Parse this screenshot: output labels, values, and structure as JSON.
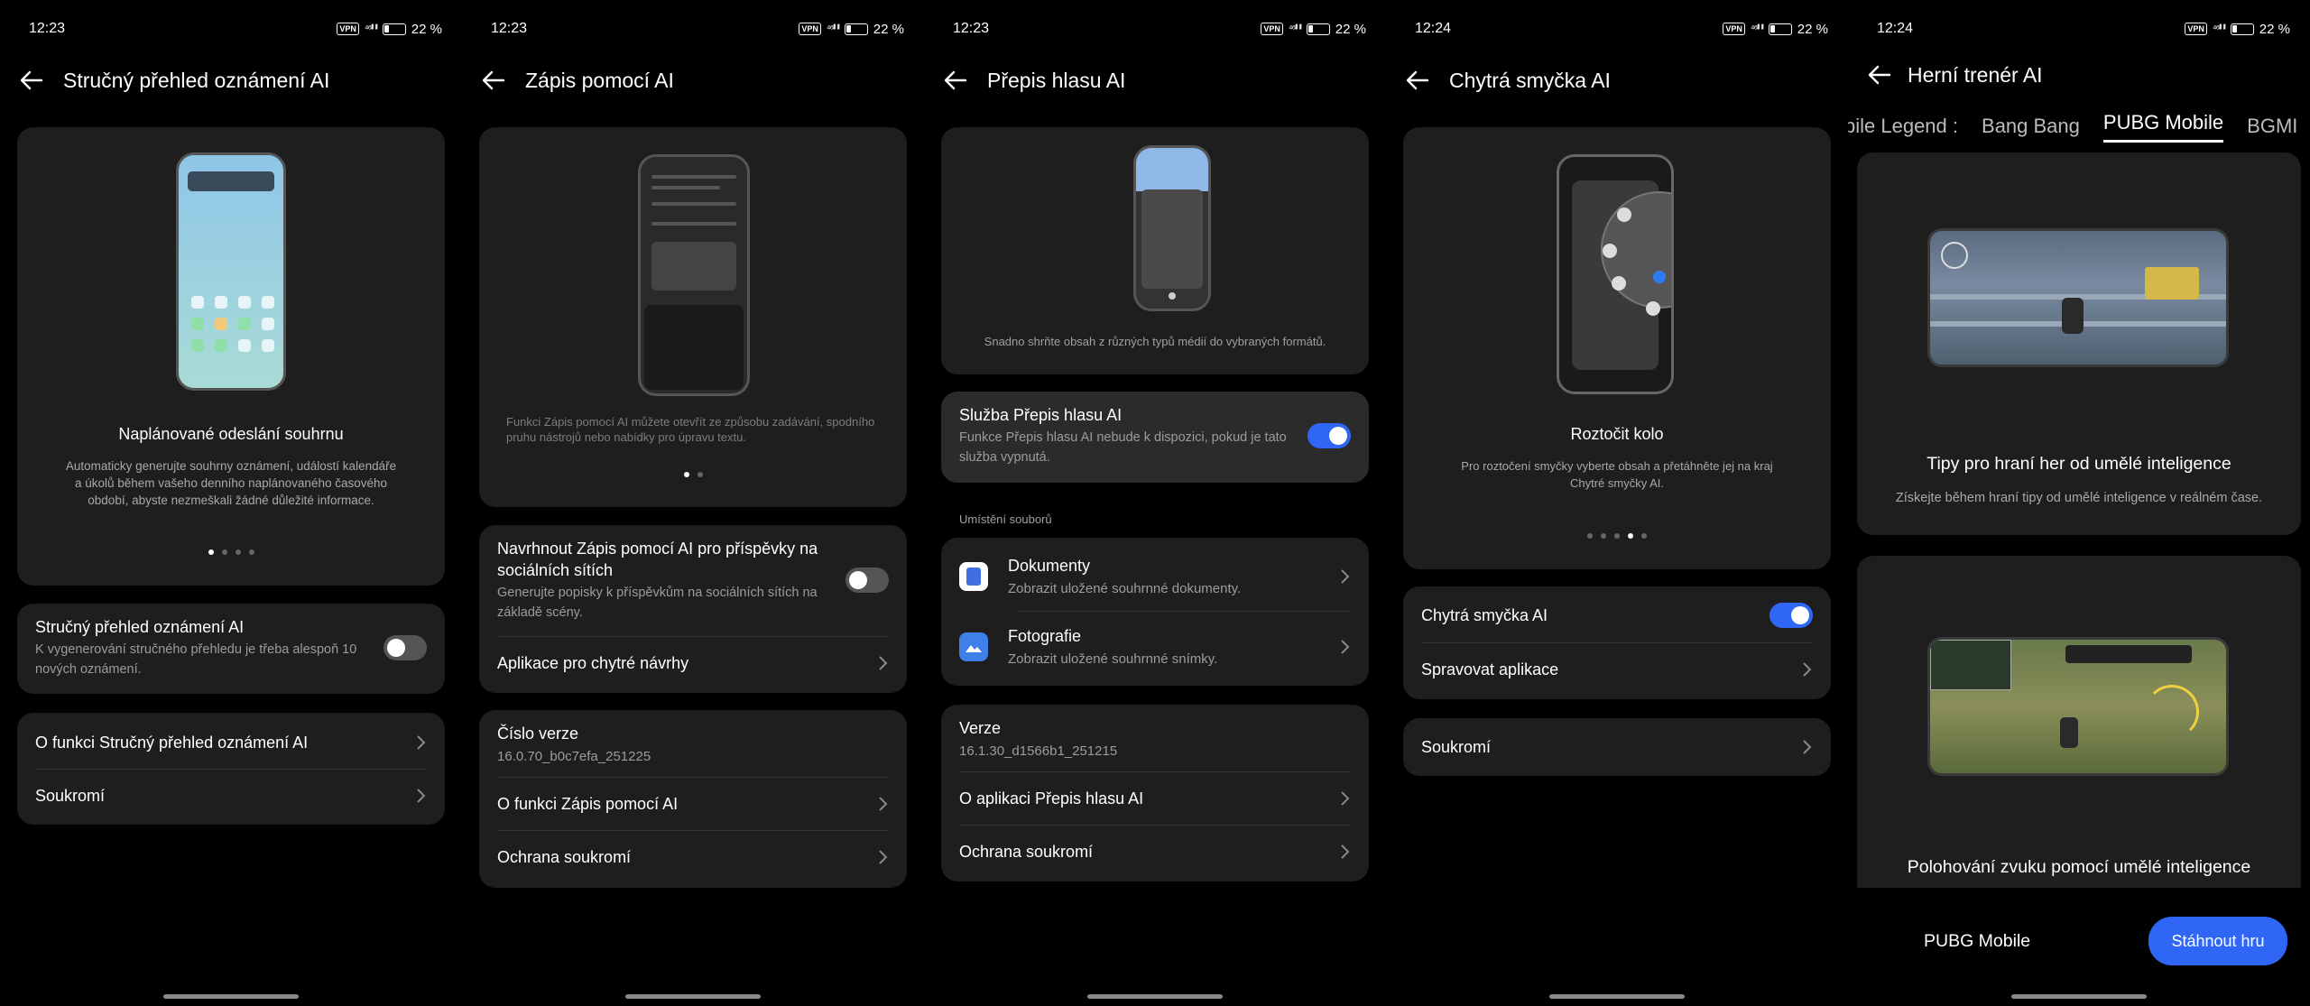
{
  "panels": [
    {
      "status": {
        "time": "12:23",
        "battery": "22 %",
        "vpn": "VPN",
        "signal": "⁴⁶ᴵˡˡ ᴵˡˡ"
      },
      "title": "Stručný přehled oznámení AI",
      "card": {
        "heading": "Naplánované odeslání souhrnu",
        "caption": "Automaticky generujte souhrny oznámení, událostí kalendáře a úkolů během vašeho denního naplánovaného časového období, abyste nezmeškali žádné důležité informace."
      },
      "toggle_row": {
        "title": "Stručný přehled oznámení AI",
        "sub": "K vygenerování stručného přehledu je třeba alespoň 10 nových oznámení.",
        "on": false
      },
      "links": [
        "O funkci Stručný přehled oznámení AI",
        "Soukromí"
      ]
    },
    {
      "status": {
        "time": "12:23",
        "battery": "22 %",
        "vpn": "VPN",
        "signal": "⁴⁶ᴵˡˡ ᴵˡˡ"
      },
      "title": "Zápis pomocí AI",
      "card": {
        "caption": "Funkci Zápis pomocí AI můžete otevřít ze způsobu zadávání, spodního pruhu nástrojů nebo nabídky pro úpravu textu."
      },
      "toggle_row": {
        "title": "Navrhnout Zápis pomocí AI pro příspěvky na sociálních sítích",
        "sub": "Generujte popisky k příspěvkům na sociálních sítích na základě scény.",
        "on": false
      },
      "suggest_apps": "Aplikace pro chytré návrhy",
      "version_label": "Číslo verze",
      "version": "16.0.70_b0c7efa_251225",
      "links": [
        "O funkci Zápis pomocí AI",
        "Ochrana soukromí"
      ]
    },
    {
      "status": {
        "time": "12:23",
        "battery": "22 %",
        "vpn": "VPN",
        "signal": "⁴⁶ᴵˡˡ ᴵˡˡ"
      },
      "title": "Přepis hlasu AI",
      "card": {
        "caption": "Snadno shrňte obsah z různých typů médií do vybraných formátů."
      },
      "toggle_row": {
        "title": "Služba Přepis hlasu AI",
        "sub": "Funkce Přepis hlasu AI nebude k dispozici, pokud je tato služba vypnutá.",
        "on": true
      },
      "section": "Umístění souborů",
      "files": [
        {
          "title": "Dokumenty",
          "sub": "Zobrazit uložené souhrnné dokumenty.",
          "icon": "documents-icon"
        },
        {
          "title": "Fotografie",
          "sub": "Zobrazit uložené souhrnné snímky.",
          "icon": "photos-icon"
        }
      ],
      "version_label": "Verze",
      "version": "16.1.30_d1566b1_251215",
      "links": [
        "O aplikaci Přepis hlasu AI",
        "Ochrana soukromí"
      ]
    },
    {
      "status": {
        "time": "12:24",
        "battery": "22 %",
        "vpn": "VPN",
        "signal": "⁴⁶ᴵˡˡ ᴵˡˡ"
      },
      "title": "Chytrá smyčka AI",
      "card": {
        "heading": "Roztočit kolo",
        "caption": "Pro roztočení smyčky vyberte obsah a přetáhněte jej na kraj Chytré smyčky AI."
      },
      "toggle_row": {
        "title": "Chytrá smyčka AI",
        "on": true
      },
      "manage_apps": "Spravovat aplikace",
      "links": [
        "Soukromí"
      ]
    },
    {
      "status": {
        "time": "12:24",
        "battery": "22 %",
        "vpn": "VPN",
        "signal": "⁴⁶ᴵˡˡ ᴵˡˡ"
      },
      "title": "Herní trenér AI",
      "tabs": [
        "bile Legend",
        "Bang Bang",
        "PUBG Mobile",
        "BGMI"
      ],
      "active_tab": "PUBG Mobile",
      "feature1": {
        "title": "Tipy pro hraní her od umělé inteligence",
        "sub": "Získejte během hraní tipy od umělé inteligence v reálném čase."
      },
      "feature2": {
        "title": "Polohování zvuku pomocí umělé inteligence"
      },
      "bottom": {
        "game": "PUBG Mobile",
        "button": "Stáhnout hru"
      }
    }
  ],
  "colors": {
    "accent": "#2f66f6",
    "card": "#1e1e1e",
    "background": "#000000"
  }
}
